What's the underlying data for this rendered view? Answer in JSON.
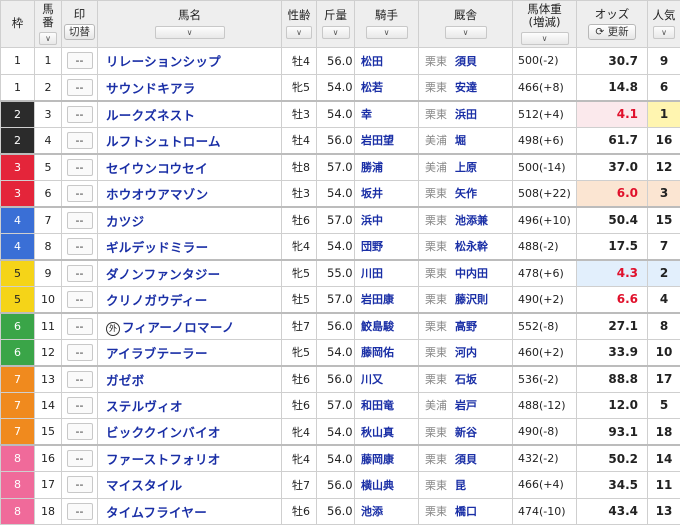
{
  "headers": {
    "waku": "枠",
    "umaban_1": "馬",
    "umaban_2": "番",
    "mark": "印",
    "mark_toggle": "切替",
    "horse_name": "馬名",
    "sex_age": "性齢",
    "weight": "斤量",
    "jockey": "騎手",
    "stable": "厩舎",
    "body_weight_1": "馬体重",
    "body_weight_2": "(増減)",
    "odds": "オッズ",
    "refresh": "更新",
    "popularity": "人気",
    "sort_glyph": "∨"
  },
  "waku_colors": {
    "1": {
      "bg": "#ffffff",
      "fg": "#222222"
    },
    "2": {
      "bg": "#2b2b2b",
      "fg": "#ffffff"
    },
    "3": {
      "bg": "#e4253a",
      "fg": "#ffffff"
    },
    "4": {
      "bg": "#3a6fd6",
      "fg": "#ffffff"
    },
    "5": {
      "bg": "#f5d418",
      "fg": "#222222"
    },
    "6": {
      "bg": "#3aa548",
      "fg": "#ffffff"
    },
    "7": {
      "bg": "#f08a1e",
      "fg": "#ffffff"
    },
    "8": {
      "bg": "#f06a9a",
      "fg": "#ffffff"
    }
  },
  "rows": [
    {
      "waku": "1",
      "umaban": "1",
      "mark": "--",
      "name": "リレーションシップ",
      "foreign": "",
      "sex_age": "牡4",
      "weight": "56.0",
      "jockey": "松田",
      "area": "栗東",
      "trainer": "須貝",
      "body_weight": "500(-2)",
      "odds": "30.7",
      "pop": "9"
    },
    {
      "waku": "1",
      "umaban": "2",
      "mark": "--",
      "name": "サウンドキアラ",
      "foreign": "",
      "sex_age": "牝5",
      "weight": "54.0",
      "jockey": "松若",
      "area": "栗東",
      "trainer": "安達",
      "body_weight": "466(+8)",
      "odds": "14.8",
      "pop": "6"
    },
    {
      "waku": "2",
      "umaban": "3",
      "mark": "--",
      "name": "ルークズネスト",
      "foreign": "",
      "sex_age": "牡3",
      "weight": "54.0",
      "jockey": "幸",
      "area": "栗東",
      "trainer": "浜田",
      "body_weight": "512(+4)",
      "odds": "4.1",
      "pop": "1"
    },
    {
      "waku": "2",
      "umaban": "4",
      "mark": "--",
      "name": "ルフトシュトローム",
      "foreign": "",
      "sex_age": "牡4",
      "weight": "56.0",
      "jockey": "岩田望",
      "area": "美浦",
      "trainer": "堀",
      "body_weight": "498(+6)",
      "odds": "61.7",
      "pop": "16"
    },
    {
      "waku": "3",
      "umaban": "5",
      "mark": "--",
      "name": "セイウンコウセイ",
      "foreign": "",
      "sex_age": "牡8",
      "weight": "57.0",
      "jockey": "勝浦",
      "area": "美浦",
      "trainer": "上原",
      "body_weight": "500(-14)",
      "odds": "37.0",
      "pop": "12"
    },
    {
      "waku": "3",
      "umaban": "6",
      "mark": "--",
      "name": "ホウオウアマゾン",
      "foreign": "",
      "sex_age": "牡3",
      "weight": "54.0",
      "jockey": "坂井",
      "area": "栗東",
      "trainer": "矢作",
      "body_weight": "508(+22)",
      "odds": "6.0",
      "pop": "3"
    },
    {
      "waku": "4",
      "umaban": "7",
      "mark": "--",
      "name": "カツジ",
      "foreign": "",
      "sex_age": "牡6",
      "weight": "57.0",
      "jockey": "浜中",
      "area": "栗東",
      "trainer": "池添兼",
      "body_weight": "496(+10)",
      "odds": "50.4",
      "pop": "15"
    },
    {
      "waku": "4",
      "umaban": "8",
      "mark": "--",
      "name": "ギルデッドミラー",
      "foreign": "",
      "sex_age": "牝4",
      "weight": "54.0",
      "jockey": "団野",
      "area": "栗東",
      "trainer": "松永幹",
      "body_weight": "488(-2)",
      "odds": "17.5",
      "pop": "7"
    },
    {
      "waku": "5",
      "umaban": "9",
      "mark": "--",
      "name": "ダノンファンタジー",
      "foreign": "",
      "sex_age": "牝5",
      "weight": "55.0",
      "jockey": "川田",
      "area": "栗東",
      "trainer": "中内田",
      "body_weight": "478(+6)",
      "odds": "4.3",
      "pop": "2"
    },
    {
      "waku": "5",
      "umaban": "10",
      "mark": "--",
      "name": "クリノガウディー",
      "foreign": "",
      "sex_age": "牡5",
      "weight": "57.0",
      "jockey": "岩田康",
      "area": "栗東",
      "trainer": "藤沢則",
      "body_weight": "490(+2)",
      "odds": "6.6",
      "pop": "4"
    },
    {
      "waku": "6",
      "umaban": "11",
      "mark": "--",
      "name": "フィアーノロマーノ",
      "foreign": "外",
      "sex_age": "牡7",
      "weight": "56.0",
      "jockey": "鮫島駿",
      "area": "栗東",
      "trainer": "高野",
      "body_weight": "552(-8)",
      "odds": "27.1",
      "pop": "8"
    },
    {
      "waku": "6",
      "umaban": "12",
      "mark": "--",
      "name": "アイラブテーラー",
      "foreign": "",
      "sex_age": "牝5",
      "weight": "54.0",
      "jockey": "藤岡佑",
      "area": "栗東",
      "trainer": "河内",
      "body_weight": "460(+2)",
      "odds": "33.9",
      "pop": "10"
    },
    {
      "waku": "7",
      "umaban": "13",
      "mark": "--",
      "name": "ガゼボ",
      "foreign": "",
      "sex_age": "牡6",
      "weight": "56.0",
      "jockey": "川又",
      "area": "栗東",
      "trainer": "石坂",
      "body_weight": "536(-2)",
      "odds": "88.8",
      "pop": "17"
    },
    {
      "waku": "7",
      "umaban": "14",
      "mark": "--",
      "name": "ステルヴィオ",
      "foreign": "",
      "sex_age": "牡6",
      "weight": "57.0",
      "jockey": "和田竜",
      "area": "美浦",
      "trainer": "岩戸",
      "body_weight": "488(-12)",
      "odds": "12.0",
      "pop": "5"
    },
    {
      "waku": "7",
      "umaban": "15",
      "mark": "--",
      "name": "ビッククインバイオ",
      "foreign": "",
      "sex_age": "牝4",
      "weight": "54.0",
      "jockey": "秋山真",
      "area": "栗東",
      "trainer": "新谷",
      "body_weight": "490(-8)",
      "odds": "93.1",
      "pop": "18"
    },
    {
      "waku": "8",
      "umaban": "16",
      "mark": "--",
      "name": "ファーストフォリオ",
      "foreign": "",
      "sex_age": "牝4",
      "weight": "54.0",
      "jockey": "藤岡康",
      "area": "栗東",
      "trainer": "須貝",
      "body_weight": "432(-2)",
      "odds": "50.2",
      "pop": "14"
    },
    {
      "waku": "8",
      "umaban": "17",
      "mark": "--",
      "name": "マイスタイル",
      "foreign": "",
      "sex_age": "牡7",
      "weight": "56.0",
      "jockey": "横山典",
      "area": "栗東",
      "trainer": "昆",
      "body_weight": "466(+4)",
      "odds": "34.5",
      "pop": "11"
    },
    {
      "waku": "8",
      "umaban": "18",
      "mark": "--",
      "name": "タイムフライヤー",
      "foreign": "",
      "sex_age": "牡6",
      "weight": "56.0",
      "jockey": "池添",
      "area": "栗東",
      "trainer": "橋口",
      "body_weight": "474(-10)",
      "odds": "43.4",
      "pop": "13"
    }
  ]
}
